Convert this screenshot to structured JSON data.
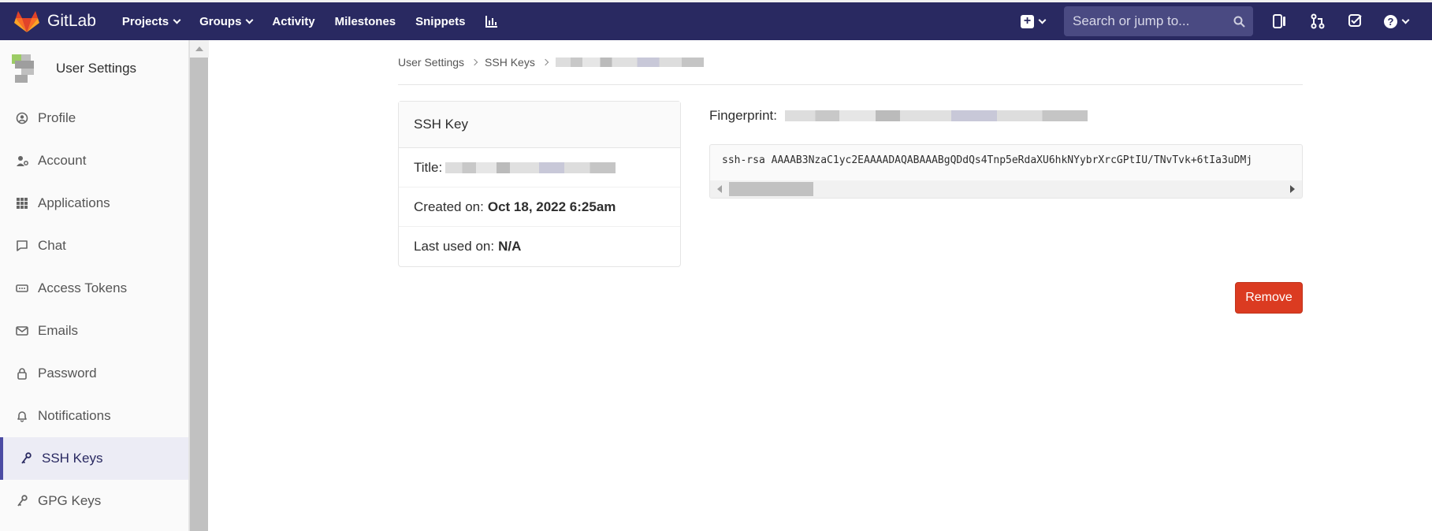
{
  "topbar": {
    "brand": "GitLab",
    "nav": [
      {
        "label": "Projects",
        "dropdown": true
      },
      {
        "label": "Groups",
        "dropdown": true
      },
      {
        "label": "Activity",
        "dropdown": false
      },
      {
        "label": "Milestones",
        "dropdown": false
      },
      {
        "label": "Snippets",
        "dropdown": false
      }
    ],
    "search_placeholder": "Search or jump to...",
    "color": "#292961"
  },
  "sidebar": {
    "title": "User Settings",
    "items": [
      {
        "label": "Profile",
        "icon": "profile-icon"
      },
      {
        "label": "Account",
        "icon": "account-icon"
      },
      {
        "label": "Applications",
        "icon": "applications-icon"
      },
      {
        "label": "Chat",
        "icon": "chat-icon"
      },
      {
        "label": "Access Tokens",
        "icon": "token-icon"
      },
      {
        "label": "Emails",
        "icon": "email-icon"
      },
      {
        "label": "Password",
        "icon": "lock-icon"
      },
      {
        "label": "Notifications",
        "icon": "bell-icon"
      },
      {
        "label": "SSH Keys",
        "icon": "key-icon",
        "active": true
      },
      {
        "label": "GPG Keys",
        "icon": "key-icon"
      }
    ]
  },
  "breadcrumb": {
    "items": [
      "User Settings",
      "SSH Keys"
    ]
  },
  "card": {
    "header": "SSH Key",
    "title_label": "Title:",
    "created_label": "Created on:",
    "created_value": "Oct 18, 2022 6:25am",
    "last_used_label": "Last used on:",
    "last_used_value": "N/A"
  },
  "fingerprint": {
    "label": "Fingerprint:"
  },
  "key": {
    "text": "ssh-rsa AAAAB3NzaC1yc2EAAAADAQABAAABgQDdQs4Tnp5eRdaXU6hkNYybrXrcGPtIU/TNvTvk+6tIa3uDMj"
  },
  "actions": {
    "remove_label": "Remove",
    "remove_color": "#db3b21"
  }
}
